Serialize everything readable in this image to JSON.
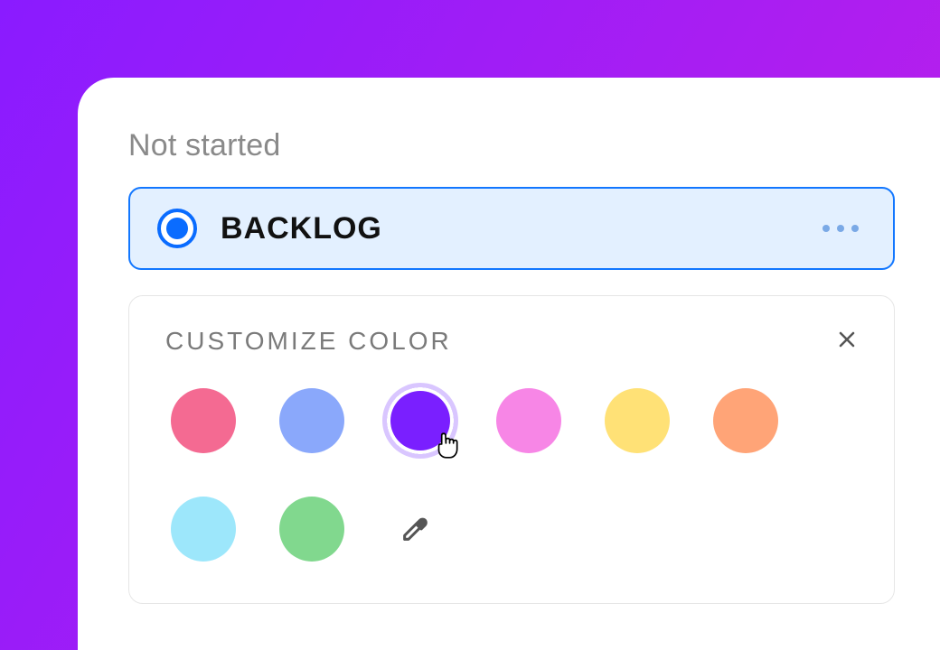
{
  "section": {
    "title": "Not started"
  },
  "status": {
    "label": "BACKLOG",
    "accent": "#0a6cff"
  },
  "color_panel": {
    "title": "CUSTOMIZE COLOR",
    "selected_index": 2,
    "swatches": [
      "#f46a92",
      "#8aa8fb",
      "#7a1fff",
      "#f786e6",
      "#ffe176",
      "#ffa477",
      "#9de7fb",
      "#81d88e"
    ]
  }
}
